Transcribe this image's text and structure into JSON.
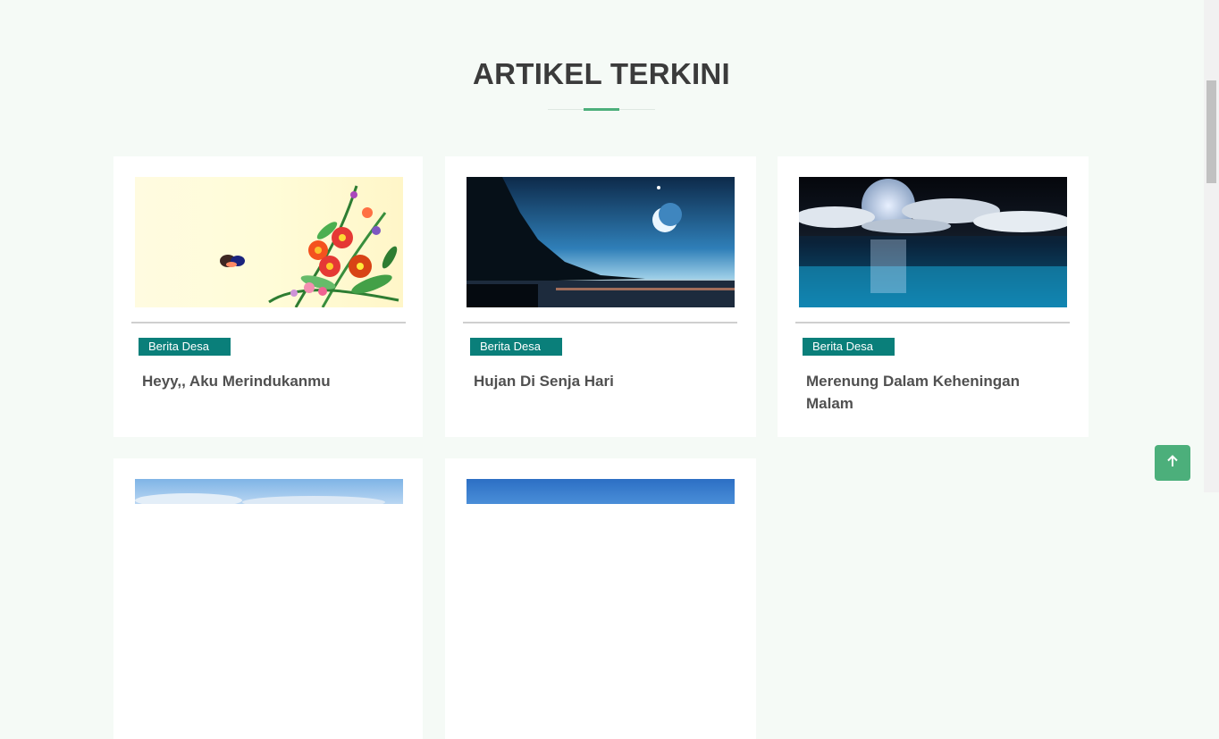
{
  "section": {
    "title": "ARTIKEL TERKINI"
  },
  "articles": [
    {
      "category": "Berita Desa",
      "title": "Heyy,, Aku Merindukanmu",
      "image": "flowers-butterfly-image"
    },
    {
      "category": "Berita Desa",
      "title": "Hujan Di Senja Hari",
      "image": "moon-lake-dusk-image"
    },
    {
      "category": "Berita Desa",
      "title": "Merenung Dalam Keheningan Malam",
      "image": "full-moon-ocean-image"
    },
    {
      "image": "sky-image"
    },
    {
      "image": "blue-sky-image"
    }
  ],
  "back_to_top": {
    "icon": "arrow-up-icon"
  },
  "colors": {
    "accent": "#4caf7b",
    "badge": "#0a7f7a",
    "background": "#f5faf6"
  }
}
